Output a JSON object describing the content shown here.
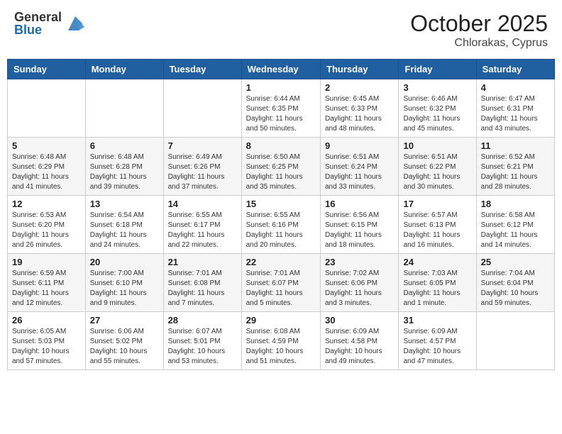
{
  "header": {
    "logo_general": "General",
    "logo_blue": "Blue",
    "month": "October 2025",
    "location": "Chlorakas, Cyprus"
  },
  "weekdays": [
    "Sunday",
    "Monday",
    "Tuesday",
    "Wednesday",
    "Thursday",
    "Friday",
    "Saturday"
  ],
  "weeks": [
    [
      {
        "day": "",
        "info": ""
      },
      {
        "day": "",
        "info": ""
      },
      {
        "day": "",
        "info": ""
      },
      {
        "day": "1",
        "info": "Sunrise: 6:44 AM\nSunset: 6:35 PM\nDaylight: 11 hours\nand 50 minutes."
      },
      {
        "day": "2",
        "info": "Sunrise: 6:45 AM\nSunset: 6:33 PM\nDaylight: 11 hours\nand 48 minutes."
      },
      {
        "day": "3",
        "info": "Sunrise: 6:46 AM\nSunset: 6:32 PM\nDaylight: 11 hours\nand 45 minutes."
      },
      {
        "day": "4",
        "info": "Sunrise: 6:47 AM\nSunset: 6:31 PM\nDaylight: 11 hours\nand 43 minutes."
      }
    ],
    [
      {
        "day": "5",
        "info": "Sunrise: 6:48 AM\nSunset: 6:29 PM\nDaylight: 11 hours\nand 41 minutes."
      },
      {
        "day": "6",
        "info": "Sunrise: 6:48 AM\nSunset: 6:28 PM\nDaylight: 11 hours\nand 39 minutes."
      },
      {
        "day": "7",
        "info": "Sunrise: 6:49 AM\nSunset: 6:26 PM\nDaylight: 11 hours\nand 37 minutes."
      },
      {
        "day": "8",
        "info": "Sunrise: 6:50 AM\nSunset: 6:25 PM\nDaylight: 11 hours\nand 35 minutes."
      },
      {
        "day": "9",
        "info": "Sunrise: 6:51 AM\nSunset: 6:24 PM\nDaylight: 11 hours\nand 33 minutes."
      },
      {
        "day": "10",
        "info": "Sunrise: 6:51 AM\nSunset: 6:22 PM\nDaylight: 11 hours\nand 30 minutes."
      },
      {
        "day": "11",
        "info": "Sunrise: 6:52 AM\nSunset: 6:21 PM\nDaylight: 11 hours\nand 28 minutes."
      }
    ],
    [
      {
        "day": "12",
        "info": "Sunrise: 6:53 AM\nSunset: 6:20 PM\nDaylight: 11 hours\nand 26 minutes."
      },
      {
        "day": "13",
        "info": "Sunrise: 6:54 AM\nSunset: 6:18 PM\nDaylight: 11 hours\nand 24 minutes."
      },
      {
        "day": "14",
        "info": "Sunrise: 6:55 AM\nSunset: 6:17 PM\nDaylight: 11 hours\nand 22 minutes."
      },
      {
        "day": "15",
        "info": "Sunrise: 6:55 AM\nSunset: 6:16 PM\nDaylight: 11 hours\nand 20 minutes."
      },
      {
        "day": "16",
        "info": "Sunrise: 6:56 AM\nSunset: 6:15 PM\nDaylight: 11 hours\nand 18 minutes."
      },
      {
        "day": "17",
        "info": "Sunrise: 6:57 AM\nSunset: 6:13 PM\nDaylight: 11 hours\nand 16 minutes."
      },
      {
        "day": "18",
        "info": "Sunrise: 6:58 AM\nSunset: 6:12 PM\nDaylight: 11 hours\nand 14 minutes."
      }
    ],
    [
      {
        "day": "19",
        "info": "Sunrise: 6:59 AM\nSunset: 6:11 PM\nDaylight: 11 hours\nand 12 minutes."
      },
      {
        "day": "20",
        "info": "Sunrise: 7:00 AM\nSunset: 6:10 PM\nDaylight: 11 hours\nand 9 minutes."
      },
      {
        "day": "21",
        "info": "Sunrise: 7:01 AM\nSunset: 6:08 PM\nDaylight: 11 hours\nand 7 minutes."
      },
      {
        "day": "22",
        "info": "Sunrise: 7:01 AM\nSunset: 6:07 PM\nDaylight: 11 hours\nand 5 minutes."
      },
      {
        "day": "23",
        "info": "Sunrise: 7:02 AM\nSunset: 6:06 PM\nDaylight: 11 hours\nand 3 minutes."
      },
      {
        "day": "24",
        "info": "Sunrise: 7:03 AM\nSunset: 6:05 PM\nDaylight: 11 hours\nand 1 minute."
      },
      {
        "day": "25",
        "info": "Sunrise: 7:04 AM\nSunset: 6:04 PM\nDaylight: 10 hours\nand 59 minutes."
      }
    ],
    [
      {
        "day": "26",
        "info": "Sunrise: 6:05 AM\nSunset: 5:03 PM\nDaylight: 10 hours\nand 57 minutes."
      },
      {
        "day": "27",
        "info": "Sunrise: 6:06 AM\nSunset: 5:02 PM\nDaylight: 10 hours\nand 55 minutes."
      },
      {
        "day": "28",
        "info": "Sunrise: 6:07 AM\nSunset: 5:01 PM\nDaylight: 10 hours\nand 53 minutes."
      },
      {
        "day": "29",
        "info": "Sunrise: 6:08 AM\nSunset: 4:59 PM\nDaylight: 10 hours\nand 51 minutes."
      },
      {
        "day": "30",
        "info": "Sunrise: 6:09 AM\nSunset: 4:58 PM\nDaylight: 10 hours\nand 49 minutes."
      },
      {
        "day": "31",
        "info": "Sunrise: 6:09 AM\nSunset: 4:57 PM\nDaylight: 10 hours\nand 47 minutes."
      },
      {
        "day": "",
        "info": ""
      }
    ]
  ]
}
